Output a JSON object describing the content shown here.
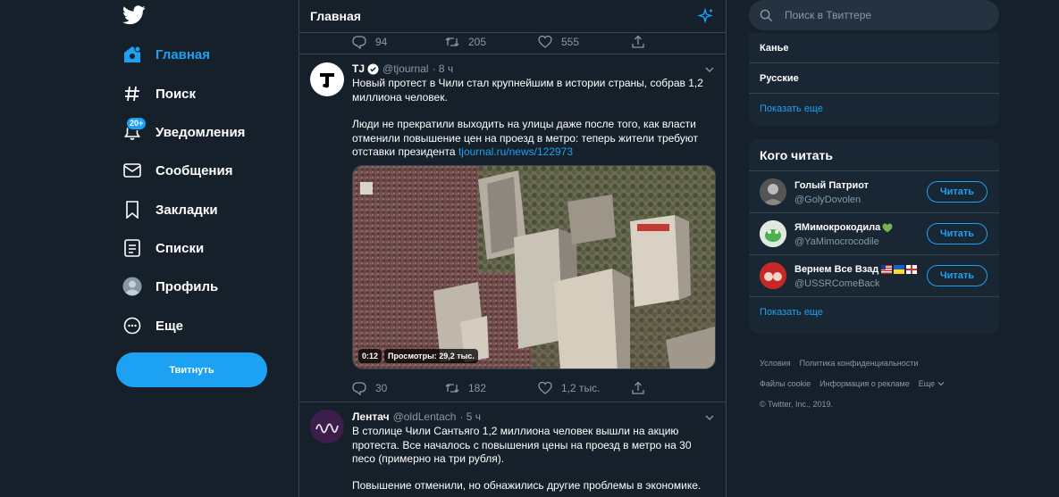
{
  "nav": {
    "items": [
      {
        "label": "Главная",
        "icon": "home-icon"
      },
      {
        "label": "Поиск",
        "icon": "hashtag-icon"
      },
      {
        "label": "Уведомления",
        "icon": "bell-icon",
        "badge": "20+"
      },
      {
        "label": "Сообщения",
        "icon": "envelope-icon"
      },
      {
        "label": "Закладки",
        "icon": "bookmark-icon"
      },
      {
        "label": "Списки",
        "icon": "list-icon"
      },
      {
        "label": "Профиль",
        "icon": "profile-icon"
      },
      {
        "label": "Еще",
        "icon": "more-icon"
      }
    ],
    "tweet_button": "Твитнуть"
  },
  "timeline": {
    "title": "Главная",
    "prev_tweet_stats": {
      "replies": "94",
      "retweets": "205",
      "likes": "555"
    },
    "tweets": [
      {
        "name": "TJ",
        "handle": "@tjournal",
        "time": "· 8 ч",
        "text1": "Новый протест в Чили стал крупнейшим в истории страны, собрав 1,2 миллиона человек.",
        "text2": "Люди не прекратили выходить на улицы даже после того, как власти отменили повышение цен на проезд в метро: теперь жители требуют отставки президента ",
        "link": "tjournal.ru/news/122973",
        "video_time": "0:12",
        "video_views": "Просмотры: 29,2 тыс.",
        "replies": "30",
        "retweets": "182",
        "likes": "1,2 тыс."
      },
      {
        "name": "Лентач",
        "handle": "@oldLentach",
        "time": "· 5 ч",
        "text1": "В столице Чили Сантьяго 1,2 миллиона человек вышли на акцию протеста. Все началось с повышения цены на проезд в метро на 30 песо (примерно на три рубля).",
        "text2": "Повышение отменили, но обнажились другие проблемы в экономике."
      }
    ]
  },
  "sidebar": {
    "search_placeholder": "Поиск в Твиттере",
    "trends": [
      "Канье",
      "Русские"
    ],
    "trends_more": "Показать еще",
    "who_title": "Кого читать",
    "who": [
      {
        "name": "Голый Патриот",
        "handle": "@GolyDovolen",
        "follow": "Читать"
      },
      {
        "name": "ЯМимокрокодила",
        "handle": "@YaMimocrocodile",
        "follow": "Читать"
      },
      {
        "name": "Вернем Все Взад",
        "handle": "@USSRComeBack",
        "follow": "Читать"
      }
    ],
    "who_more": "Показать еще",
    "footer": {
      "terms": "Условия",
      "privacy": "Политика конфиденциальности",
      "cookies": "Файлы cookie",
      "ads": "Информация о рекламе",
      "more": "Еще",
      "copyright": "© Twitter, Inc., 2019."
    }
  },
  "colors": {
    "bg": "#15202b",
    "accent": "#1da1f2",
    "muted": "#8899a6",
    "panel": "#192734",
    "border": "#38444d"
  }
}
